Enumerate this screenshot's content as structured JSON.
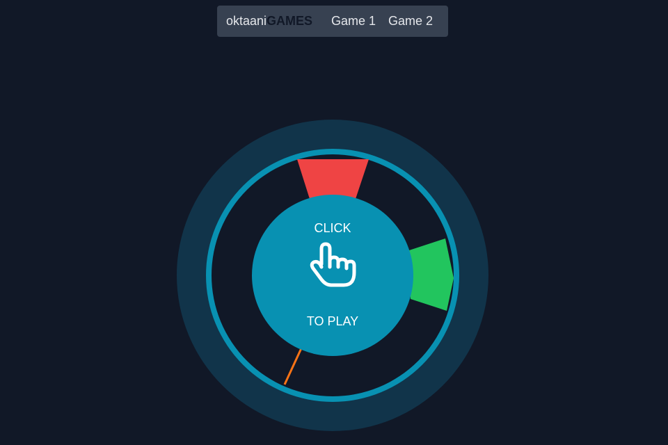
{
  "nav": {
    "brand_light": "oktaani",
    "brand_bold": "GAMES",
    "links": [
      "Game 1",
      "Game 2"
    ]
  },
  "game": {
    "center_top_text": "CLICK",
    "center_bottom_text": "TO PLAY",
    "center_icon": "pointing-hand-icon",
    "target_zones": [
      {
        "name": "red-zone",
        "color": "#ef4444"
      },
      {
        "name": "green-zone",
        "color": "#22c55e"
      }
    ],
    "indicator_color": "#f97316",
    "colors": {
      "background": "#111827",
      "outer_ring": "#11344a",
      "track_border": "#0891b2",
      "center_button": "#0891b2",
      "nav_bg": "#374151"
    }
  }
}
